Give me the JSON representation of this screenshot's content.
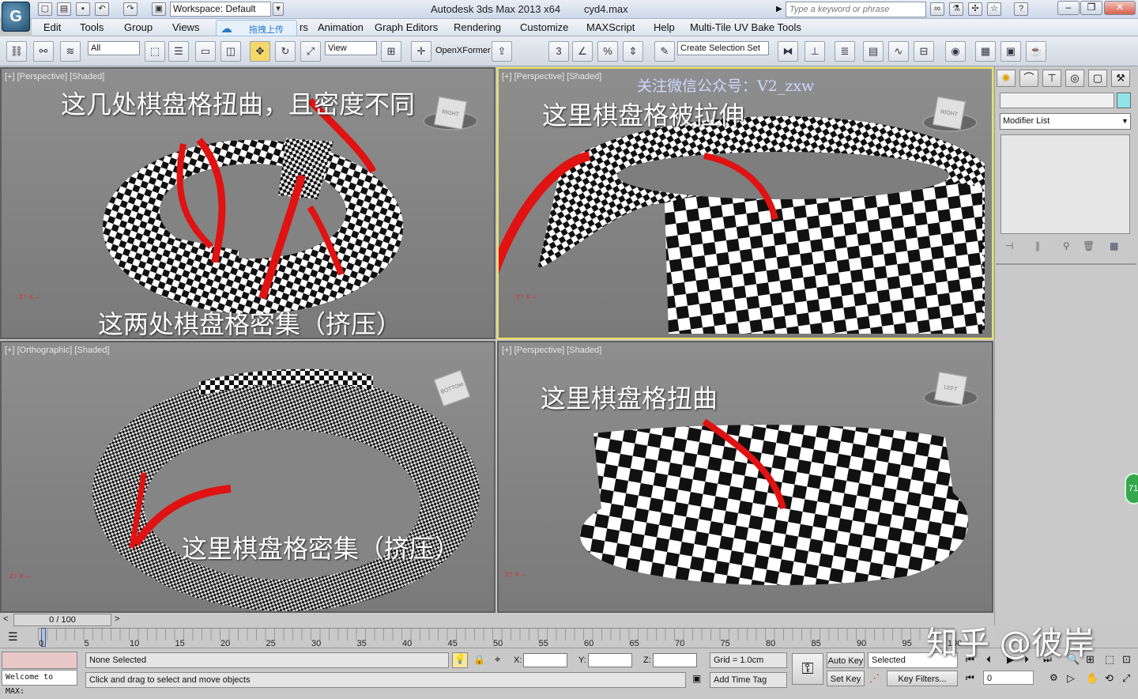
{
  "titlebar": {
    "workspace_label": "Workspace: Default",
    "app_title": "Autodesk 3ds Max  2013 x64",
    "file_name": "cyd4.max",
    "search_placeholder": "Type a keyword or phrase"
  },
  "menubar": {
    "items": [
      "Edit",
      "Tools",
      "Group",
      "Views",
      "rs",
      "Animation",
      "Graph Editors",
      "Rendering",
      "Customize",
      "MAXScript",
      "Help",
      "Multi-Tile UV Bake Tools"
    ],
    "upload_chip": "拖拽上传"
  },
  "toolbar": {
    "selection_filter": "All",
    "ref_coord": "View",
    "openx_label": "OpenXFormer",
    "selection_set_placeholder": "Create Selection Set"
  },
  "viewports": {
    "top_left": {
      "label": "[+] [Perspective] [Shaded]",
      "note_top": "这几处棋盘格扭曲，且密度不同",
      "note_bottom": "这两处棋盘格密集（挤压）"
    },
    "top_right": {
      "label": "[+] [Perspective] [Shaded]",
      "watermark": "关注微信公众号：V2_zxw",
      "note": "这里棋盘格被拉伸"
    },
    "bottom_left": {
      "label": "[+] [Orthographic] [Shaded]",
      "note": "这里棋盘格密集（挤压）"
    },
    "bottom_right": {
      "label": "[+] [Perspective] [Shaded]",
      "note": "这里棋盘格扭曲"
    }
  },
  "command_panel": {
    "modifier_list": "Modifier List"
  },
  "timeline": {
    "frame_readout": "0 / 100",
    "ticks": [
      "0",
      "5",
      "10",
      "15",
      "20",
      "25",
      "30",
      "35",
      "40",
      "45",
      "50",
      "55",
      "60",
      "65",
      "70",
      "75",
      "80",
      "85",
      "90",
      "95",
      "100"
    ]
  },
  "statusbar": {
    "maxscript_text": "Welcome to MAX:",
    "selection_status": "None Selected",
    "prompt": "Click and drag to select and move objects",
    "x_label": "X:",
    "y_label": "Y:",
    "z_label": "Z:",
    "grid": "Grid = 1.0cm",
    "add_time_tag": "Add Time Tag",
    "auto_key": "Auto Key",
    "set_key": "Set Key",
    "key_mode": "Selected",
    "key_filters": "Key Filters...",
    "current_frame": "0"
  },
  "overlay": {
    "zhihu_watermark": "知乎 @彼岸",
    "badge": "71"
  }
}
